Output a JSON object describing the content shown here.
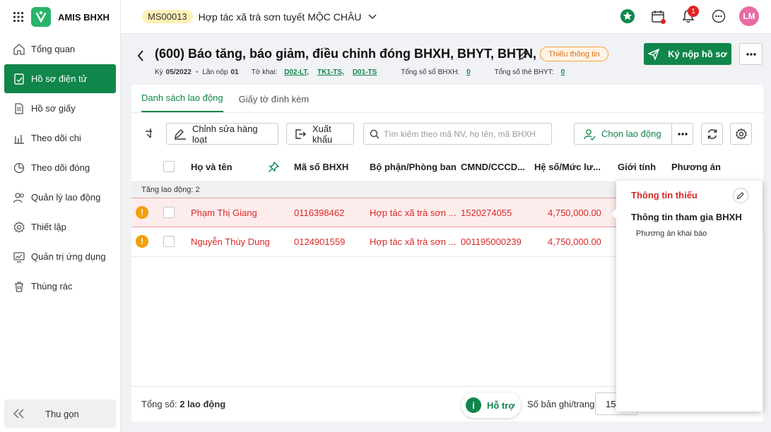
{
  "app": {
    "name": "AMIS BHXH"
  },
  "sidebar": {
    "items": [
      {
        "label": "Tổng quan",
        "icon": "home-icon"
      },
      {
        "label": "Hồ sơ điện tử",
        "icon": "electronic-file-icon",
        "active": true
      },
      {
        "label": "Hồ sơ giấy",
        "icon": "document-icon"
      },
      {
        "label": "Theo dõi chi",
        "icon": "bar-chart-icon"
      },
      {
        "label": "Theo dõi đóng",
        "icon": "pie-chart-icon"
      },
      {
        "label": "Quản lý lao động",
        "icon": "users-icon"
      },
      {
        "label": "Thiết lập",
        "icon": "gear-icon"
      },
      {
        "label": "Quản trị ứng dụng",
        "icon": "monitor-chart-icon"
      },
      {
        "label": "Thùng rác",
        "icon": "trash-icon"
      }
    ],
    "collapse_label": "Thu gọn"
  },
  "topbar": {
    "org_code": "MS00013",
    "org_name": "Hợp tác xã trà sơn tuyết MỘC CHÂU",
    "notification_count": "1",
    "avatar_initials": "LM"
  },
  "page": {
    "title": "(600) Báo tăng, báo giảm, điều chỉnh đóng BHXH, BHYT, BHTN, ...",
    "status_tag": "Thiếu thông tin",
    "sign_button": "Ký nộp hồ sơ",
    "meta": {
      "period_label": "Kỳ",
      "period_value": "05/2022",
      "submit_label": "Lần nộp",
      "submit_value": "01",
      "forms_label": "Tờ khai:",
      "forms": [
        "D02-LT,",
        "TK1-TS,",
        "D01-TS"
      ],
      "bhxh_count_label": "Tổng số sổ BHXH:",
      "bhxh_count": "0",
      "bhyt_count_label": "Tổng số thẻ BHYT:",
      "bhyt_count": "0"
    }
  },
  "tabs": [
    {
      "label": "Danh sách lao động",
      "active": true
    },
    {
      "label": "Giấy tờ đính kèm",
      "active": false
    }
  ],
  "toolbar": {
    "bulk_edit": "Chỉnh sửa hàng loạt",
    "export": "Xuất khẩu",
    "search_placeholder": "Tìm kiếm theo mã NV, họ tên, mã BHXH",
    "choose_employee": "Chọn lao động"
  },
  "table": {
    "columns": [
      "Họ và tên",
      "Mã số BHXH",
      "Bộ phận/Phòng ban",
      "CMND/CCCD...",
      "Hệ số/Mức lư...",
      "Giới tính",
      "Phương án"
    ],
    "group_label": "Tăng lao động: 2",
    "rows": [
      {
        "name": "Phạm Thị Giang",
        "bhxh": "0116398462",
        "dept": "Hợp tác xã trà sơn ...",
        "id": "1520274055",
        "salary": "4,750,000.00"
      },
      {
        "name": "Nguyễn Thùy Dung",
        "bhxh": "0124901559",
        "dept": "Hợp tác xã trà sơn ...",
        "id": "001195000239",
        "salary": "4,750,000.00"
      }
    ]
  },
  "footer": {
    "total_label": "Tổng số:",
    "total_value": "2 lao động",
    "per_page_label": "Số bản ghi/trang",
    "per_page_value": "15"
  },
  "support": {
    "label": "Hỗ trợ"
  },
  "popover": {
    "title": "Thông tin thiếu",
    "section": "Thông tin tham gia BHXH",
    "item": "Phương án khai báo"
  },
  "colors": {
    "primary": "#10864b",
    "error": "#d92828",
    "warning": "#f0a10a"
  }
}
